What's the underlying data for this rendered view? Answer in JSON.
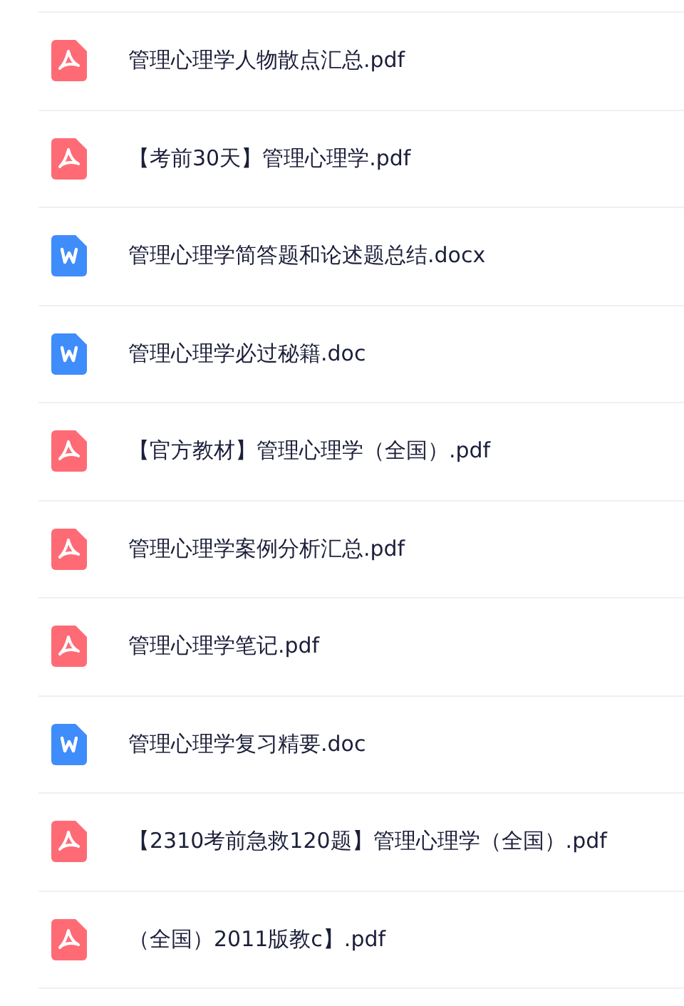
{
  "files": [
    {
      "kind": "pdf",
      "name": "管理心理学人物散点汇总.pdf"
    },
    {
      "kind": "pdf",
      "name": "【考前30天】管理心理学.pdf"
    },
    {
      "kind": "word",
      "name": "管理心理学简答题和论述题总结.docx"
    },
    {
      "kind": "word",
      "name": "管理心理学必过秘籍.doc"
    },
    {
      "kind": "pdf",
      "name": "【官方教材】管理心理学（全国）.pdf"
    },
    {
      "kind": "pdf",
      "name": "管理心理学案例分析汇总.pdf"
    },
    {
      "kind": "pdf",
      "name": "管理心理学笔记.pdf"
    },
    {
      "kind": "word",
      "name": "管理心理学复习精要.doc"
    },
    {
      "kind": "pdf",
      "name": "【2310考前急救120题】管理心理学（全国）.pdf"
    },
    {
      "kind": "pdf",
      "name": "（全国）2011版教c】.pdf"
    }
  ]
}
